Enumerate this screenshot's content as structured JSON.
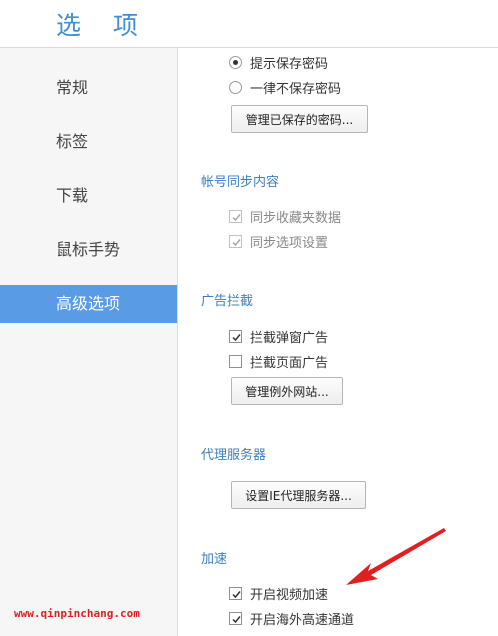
{
  "window": {
    "title": "选 项"
  },
  "sidebar": {
    "items": [
      {
        "label": "常规",
        "active": false
      },
      {
        "label": "标签",
        "active": false
      },
      {
        "label": "下载",
        "active": false
      },
      {
        "label": "鼠标手势",
        "active": false
      },
      {
        "label": "高级选项",
        "active": true
      }
    ]
  },
  "password": {
    "prompt_save": "提示保存密码",
    "never_save": "一律不保存密码",
    "manage_button": "管理已保存的密码..."
  },
  "sync": {
    "title": "帐号同步内容",
    "favorites": "同步收藏夹数据",
    "options": "同步选项设置"
  },
  "adblock": {
    "title": "广告拦截",
    "popup": "拦截弹窗广告",
    "page": "拦截页面广告",
    "manage_button": "管理例外网站..."
  },
  "proxy": {
    "title": "代理服务器",
    "button": "设置IE代理服务器..."
  },
  "accel": {
    "title": "加速",
    "video": "开启视频加速",
    "overseas": "开启海外高速通道"
  },
  "watermark": {
    "text": "www.qinpinchang.com"
  },
  "colors": {
    "accent": "#5a9be6",
    "title": "#3f8fd2",
    "section": "#3a7fc4",
    "annotation": "#e02020"
  }
}
